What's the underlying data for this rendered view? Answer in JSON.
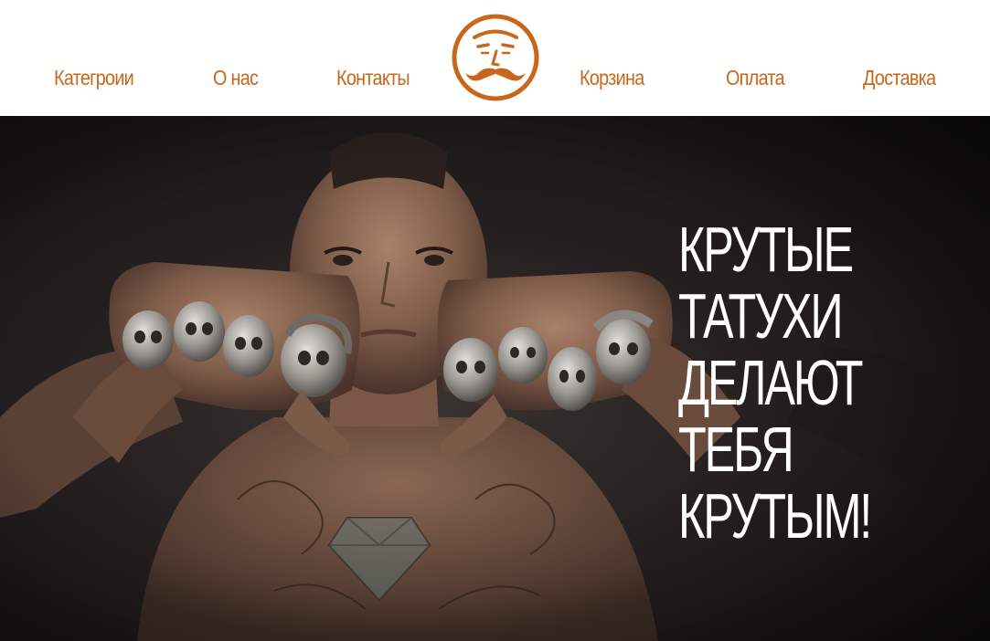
{
  "nav": {
    "left": [
      {
        "label": "Категроии"
      },
      {
        "label": "О нас"
      },
      {
        "label": "Контакты"
      }
    ],
    "right": [
      {
        "label": "Корзина"
      },
      {
        "label": "Оплата"
      },
      {
        "label": "Доставка"
      }
    ]
  },
  "logo": {
    "icon": "mustache-face-logo-icon"
  },
  "hero": {
    "title": "КРУТЫЕ\nТАТУХИ\nДЕЛАЮТ\nТЕБЯ\nКРУТЫМ!",
    "image": "tattooed-man-with-skull-rings"
  },
  "colors": {
    "accent": "#c9661c",
    "hero_text": "#ffffff",
    "hero_bg": "#1c1819"
  }
}
